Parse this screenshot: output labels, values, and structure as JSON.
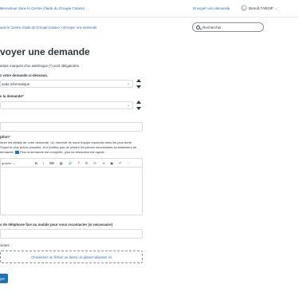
{
  "header": {
    "welcome": "Bienvenue dans le Centre d'aide du Groupe Casavo",
    "submit_request_link": "Envoyer une demande",
    "user_name": "Benoît TARDIF",
    "user_caret": "⌄"
  },
  "breadcrumb": "aide le Centre d'aide du Groupe Casavo  >  Envoyer une demande",
  "search": {
    "placeholder": "Rechercher"
  },
  "page": {
    "title": "voyer une demande",
    "required_note": "amps marqués d'un astérisque (*) sont obligatoires."
  },
  "form": {
    "request_type_label": "z votre demande ci-dessous.",
    "request_type_value": "ande informatique",
    "request_type_chevron": "⌄",
    "nature_label": "e la demande*",
    "nature_chevron": "⌄",
    "description_label": "ption*",
    "description_help_1": "ntrez les détails de votre demande. Un membre de notre équipe répondra dans les plus brefs",
    "description_help_2": "Soyez le plus précis possible, et n'oubliez pas de joindre les pièces nécessaires au traitement de",
    "description_help_3": "demande.",
    "description_help_4": "Plus la demande est complète, plus sa résolution est rapide.",
    "phone_label": "o de téléphone fixe ou mobile pour vous recontacter (si nécessaire)",
    "attachments_label": "ointes",
    "dropzone": "Choisissez un fichier ou faites un glisser-déposer ici",
    "submit_button": "yer"
  },
  "editor_toolbar": {
    "style": "graphe",
    "style_chevron": "⌄",
    "bold": "B",
    "italic": "I",
    "code": "⌨",
    "table": "▦",
    "link": "🔗",
    "quote": "❝",
    "bullets": "☰",
    "numbers": "☷",
    "indent": "⇥",
    "image": "▣",
    "undo": "↶",
    "more": "⋯"
  },
  "colors": {
    "link": "#2a6ebb",
    "primary_button": "#1f73b7",
    "border": "#d8dcde",
    "text": "#2f3941"
  }
}
